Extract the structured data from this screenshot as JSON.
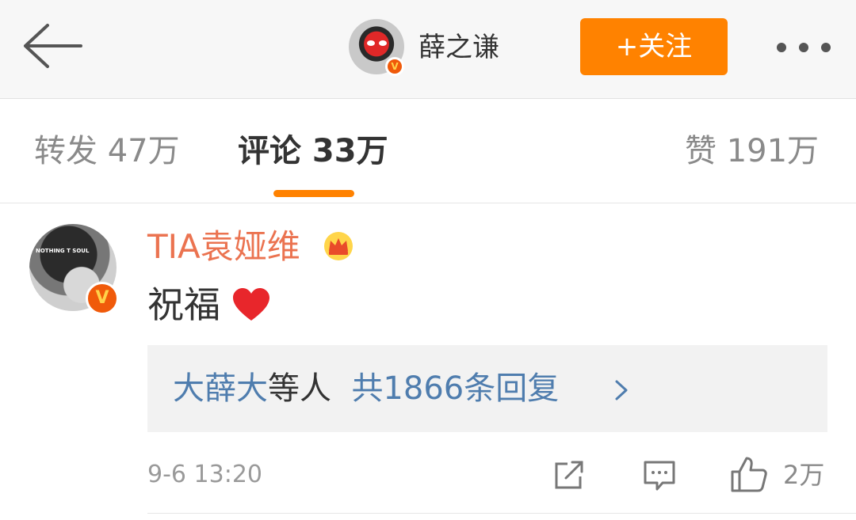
{
  "header": {
    "user_name": "薛之谦",
    "follow_label": "+关注",
    "verified_label": "V",
    "accent_color": "#ff8200"
  },
  "tabs": {
    "repost": "转发 47万",
    "comments": "评论 33万",
    "likes": "赞 191万",
    "active": "comments"
  },
  "comment": {
    "author": "TIA袁娅维",
    "author_color": "#eb7350",
    "avatar_text": "NOTHING\nT SOUL",
    "verified_label": "V",
    "text": "祝福",
    "reply_users": "大薛大",
    "reply_middle": "等人",
    "reply_count": "共1866条回复",
    "time": "9-6 13:20",
    "like_count": "2万"
  },
  "icons": [
    "back-arrow-icon",
    "more-icon",
    "crown-icon",
    "heart-icon",
    "chevron-right-icon",
    "share-icon",
    "comment-icon",
    "like-icon"
  ]
}
